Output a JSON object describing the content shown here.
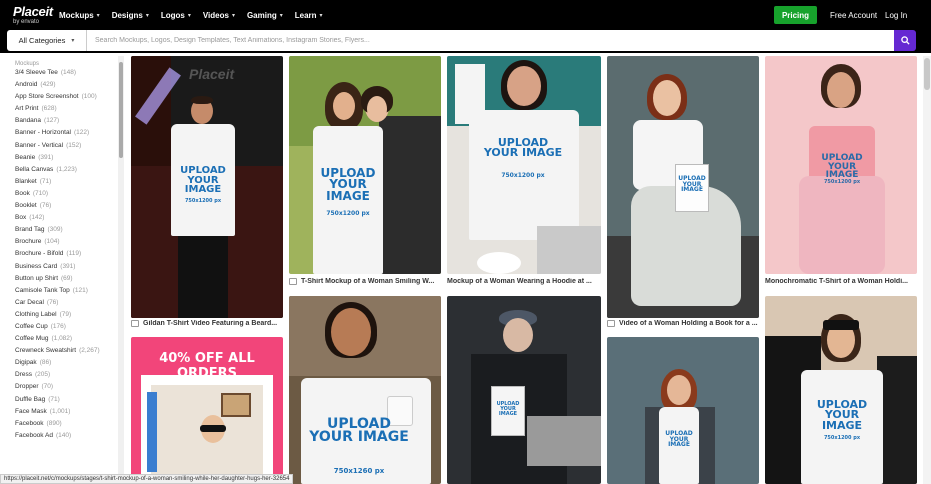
{
  "brand": {
    "name": "Placeit",
    "sub": "by envato"
  },
  "nav": [
    {
      "label": "Mockups"
    },
    {
      "label": "Designs"
    },
    {
      "label": "Logos"
    },
    {
      "label": "Videos"
    },
    {
      "label": "Gaming"
    },
    {
      "label": "Learn"
    }
  ],
  "header": {
    "pricing": "Pricing",
    "create_account": "Free Account",
    "login": "Log In"
  },
  "search": {
    "category": "All Categories",
    "placeholder": "Search Mockups, Logos, Design Templates, Text Animations, Instagram Stories, Flyers..."
  },
  "sidebar": {
    "heading": "Mockups",
    "items": [
      {
        "label": "3/4 Sleeve Tee",
        "count": "(148)"
      },
      {
        "label": "Android",
        "count": "(429)"
      },
      {
        "label": "App Store Screenshot",
        "count": "(100)"
      },
      {
        "label": "Art Print",
        "count": "(628)"
      },
      {
        "label": "Bandana",
        "count": "(127)"
      },
      {
        "label": "Banner - Horizontal",
        "count": "(122)"
      },
      {
        "label": "Banner - Vertical",
        "count": "(152)"
      },
      {
        "label": "Beanie",
        "count": "(391)"
      },
      {
        "label": "Bella Canvas",
        "count": "(1,223)"
      },
      {
        "label": "Blanket",
        "count": "(71)"
      },
      {
        "label": "Book",
        "count": "(710)"
      },
      {
        "label": "Booklet",
        "count": "(76)"
      },
      {
        "label": "Box",
        "count": "(142)"
      },
      {
        "label": "Brand Tag",
        "count": "(309)"
      },
      {
        "label": "Brochure",
        "count": "(104)"
      },
      {
        "label": "Brochure - Bifold",
        "count": "(119)"
      },
      {
        "label": "Business Card",
        "count": "(391)"
      },
      {
        "label": "Button up Shirt",
        "count": "(69)"
      },
      {
        "label": "Camisole Tank Top",
        "count": "(121)"
      },
      {
        "label": "Car Decal",
        "count": "(76)"
      },
      {
        "label": "Clothing Label",
        "count": "(79)"
      },
      {
        "label": "Coffee Cup",
        "count": "(176)"
      },
      {
        "label": "Coffee Mug",
        "count": "(1,082)"
      },
      {
        "label": "Crewneck Sweatshirt",
        "count": "(2,267)"
      },
      {
        "label": "Digipak",
        "count": "(86)"
      },
      {
        "label": "Dress",
        "count": "(205)"
      },
      {
        "label": "Dropper",
        "count": "(70)"
      },
      {
        "label": "Duffle Bag",
        "count": "(71)"
      },
      {
        "label": "Face Mask",
        "count": "(1,001)"
      },
      {
        "label": "Facebook",
        "count": "(890)"
      },
      {
        "label": "Facebook Ad",
        "count": "(140)"
      }
    ]
  },
  "cards": [
    {
      "caption": "Gildan T-Shirt Video Featuring a Beard...",
      "overlay": "Placeit",
      "upload": "UPLOAD YOUR IMAGE",
      "size": "750x1200 px"
    },
    {
      "caption": "T-Shirt Mockup of a Woman Smiling W...",
      "upload": "UPLOAD YOUR IMAGE",
      "size": "750x1200 px"
    },
    {
      "caption": "Mockup of a Woman Wearing a Hoodie at ...",
      "upload": "UPLOAD YOUR IMAGE",
      "size": "750x1200 px"
    },
    {
      "caption": "Video of a Woman Holding a Book for a ...",
      "upload": "UPLOAD YOUR IMAGE",
      "size": "750x1200 px"
    },
    {
      "caption": "Monochromatic T-Shirt of a Woman Holdi...",
      "upload": "UPLOAD YOUR IMAGE",
      "size": "750x1200 px"
    },
    {
      "caption": "",
      "promo": "40% OFF ALL ORDERS"
    },
    {
      "caption": "",
      "upload": "UPLOAD YOUR IMAGE",
      "size": "750x1260 px"
    },
    {
      "caption": "",
      "upload": "UPLOAD YOUR IMAGE",
      "size": ""
    },
    {
      "caption": "",
      "upload": "UPLOAD YOUR IMAGE",
      "size": ""
    },
    {
      "caption": "",
      "upload": "UPLOAD YOUR IMAGE",
      "size": "750x1200 px"
    }
  ],
  "status_url": "https://placeit.net/c/mockups/stages/t-shirt-mockup-of-a-woman-smiling-while-her-daughter-hugs-her-32654",
  "colors": {
    "brand_green": "#17a22c",
    "search_purple": "#6528d2",
    "upload_blue": "#1b6fb5",
    "promo_pink": "#f2457a"
  }
}
